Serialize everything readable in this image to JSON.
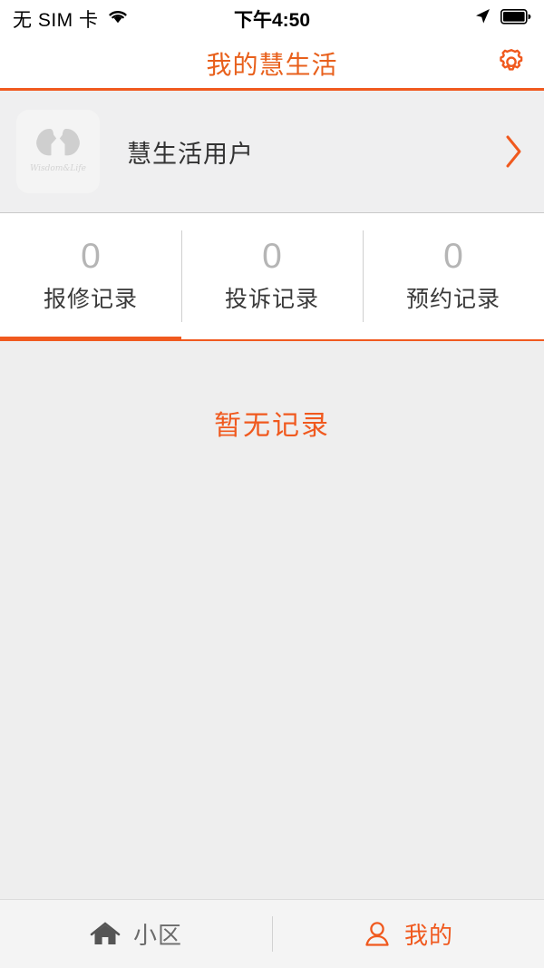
{
  "status_bar": {
    "carrier": "无 SIM 卡",
    "wifi_icon": "wifi-icon",
    "time": "下午4:50",
    "location_icon": "location-arrow-icon",
    "battery_icon": "battery-full-icon"
  },
  "header": {
    "title": "我的慧生活",
    "settings_icon": "gear-icon",
    "accent_color": "#e8601c",
    "divider_color": "#f0591e"
  },
  "profile": {
    "avatar_icon": "app-logo-avatar",
    "avatar_logo_text": "Wisdom&Life",
    "name": "慧生活用户",
    "chevron_icon": "chevron-right-icon"
  },
  "tabs": {
    "active_index": 0,
    "items": [
      {
        "count": "0",
        "label": "报修记录"
      },
      {
        "count": "0",
        "label": "投诉记录"
      },
      {
        "count": "0",
        "label": "预约记录"
      }
    ]
  },
  "content": {
    "empty_text": "暂无记录",
    "empty_text_color": "#f0591e",
    "background_color": "#eeeeee"
  },
  "bottom_nav": {
    "items": [
      {
        "label": "小区",
        "icon": "home-icon",
        "active": false
      },
      {
        "label": "我的",
        "icon": "person-icon",
        "active": true
      }
    ],
    "active_color": "#f0591e",
    "inactive_color": "#6b6b6b"
  }
}
